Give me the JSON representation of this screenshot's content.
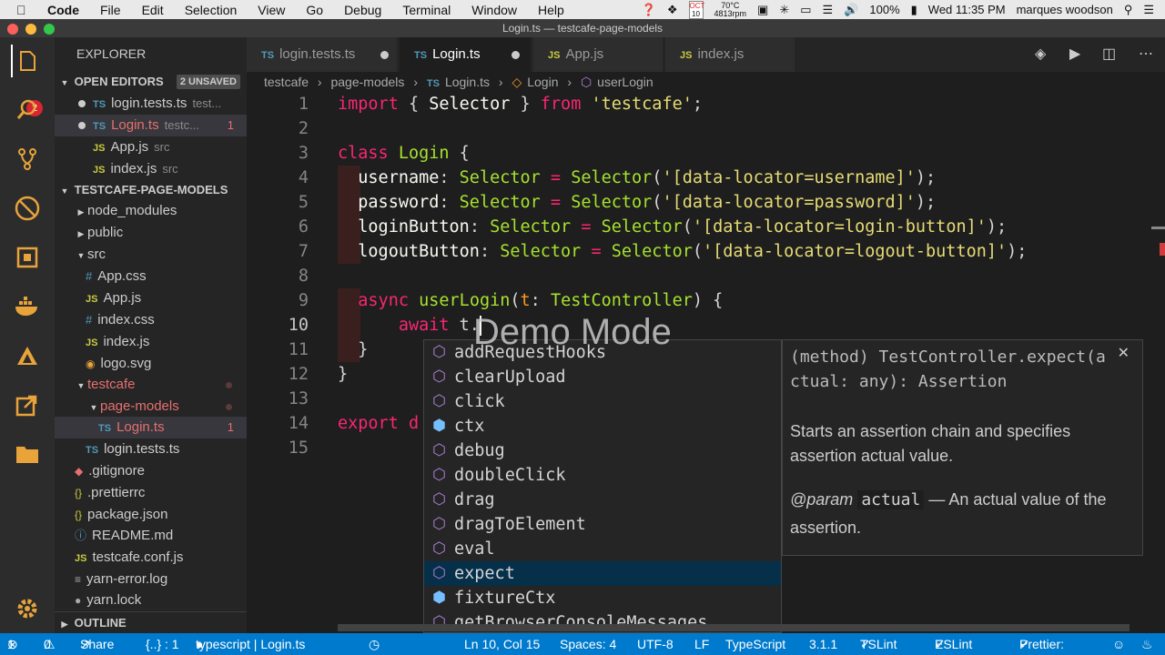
{
  "menubar": {
    "app": "Code",
    "items": [
      "File",
      "Edit",
      "Selection",
      "View",
      "Go",
      "Debug",
      "Terminal",
      "Window",
      "Help"
    ],
    "temp": "70°C",
    "rpm": "4813rpm",
    "date_day": "10",
    "date_month": "OCT",
    "battery": "100%",
    "clock": "Wed 11:35 PM",
    "user": "marques woodson"
  },
  "window_title": "Login.ts — testcafe-page-models",
  "activity": {
    "scm_badge": "2"
  },
  "explorer": {
    "title": "EXPLORER",
    "open_editors_label": "OPEN EDITORS",
    "unsaved_label": "2 UNSAVED",
    "open_editors": [
      {
        "icon": "TS",
        "name": "login.tests.ts",
        "hint": "test..."
      },
      {
        "icon": "TS",
        "name": "Login.ts",
        "hint": "testc...",
        "problems": "1"
      },
      {
        "icon": "JS",
        "name": "App.js",
        "hint": "src"
      },
      {
        "icon": "JS",
        "name": "index.js",
        "hint": "src"
      }
    ],
    "project_label": "TESTCAFE-PAGE-MODELS",
    "tree": [
      {
        "name": "node_modules",
        "kind": "folder"
      },
      {
        "name": "public",
        "kind": "folder"
      },
      {
        "name": "src",
        "kind": "folder-open"
      },
      {
        "name": "App.css",
        "kind": "css"
      },
      {
        "name": "App.js",
        "kind": "js"
      },
      {
        "name": "index.css",
        "kind": "css"
      },
      {
        "name": "index.js",
        "kind": "js"
      },
      {
        "name": "logo.svg",
        "kind": "svg"
      },
      {
        "name": "testcafe",
        "kind": "folder-open"
      },
      {
        "name": "page-models",
        "kind": "folder-open"
      },
      {
        "name": "Login.ts",
        "kind": "ts",
        "problems": "1"
      },
      {
        "name": "login.tests.ts",
        "kind": "ts"
      },
      {
        "name": ".gitignore",
        "kind": "git"
      },
      {
        "name": ".prettierrc",
        "kind": "json"
      },
      {
        "name": "package.json",
        "kind": "json"
      },
      {
        "name": "README.md",
        "kind": "md"
      },
      {
        "name": "testcafe.conf.js",
        "kind": "js"
      },
      {
        "name": "yarn-error.log",
        "kind": "log"
      },
      {
        "name": "yarn.lock",
        "kind": "lock"
      }
    ],
    "outline_label": "OUTLINE"
  },
  "tabs": [
    {
      "icon": "TS",
      "label": "login.tests.ts"
    },
    {
      "icon": "TS",
      "label": "Login.ts"
    },
    {
      "icon": "JS",
      "label": "App.js"
    },
    {
      "icon": "JS",
      "label": "index.js"
    }
  ],
  "breadcrumb": [
    "testcafe",
    "page-models",
    "Login.ts",
    "Login",
    "userLogin"
  ],
  "editor": {
    "line_numbers": [
      "1",
      "2",
      "3",
      "4",
      "5",
      "6",
      "7",
      "8",
      "9",
      "10",
      "11",
      "12",
      "13",
      "14",
      "15"
    ]
  },
  "suggestions": [
    {
      "label": "addRequestHooks",
      "kind": "method"
    },
    {
      "label": "clearUpload",
      "kind": "method"
    },
    {
      "label": "click",
      "kind": "method"
    },
    {
      "label": "ctx",
      "kind": "field"
    },
    {
      "label": "debug",
      "kind": "method"
    },
    {
      "label": "doubleClick",
      "kind": "method"
    },
    {
      "label": "drag",
      "kind": "method"
    },
    {
      "label": "dragToElement",
      "kind": "method"
    },
    {
      "label": "eval",
      "kind": "method"
    },
    {
      "label": "expect",
      "kind": "method"
    },
    {
      "label": "fixtureCtx",
      "kind": "field"
    },
    {
      "label": "getBrowserConsoleMessages",
      "kind": "method"
    }
  ],
  "docs": {
    "signature": "(method) TestController.expect(actual: any): Assertion",
    "description": "Starts an assertion chain and specifies assertion actual value.",
    "param_tag": "@param",
    "param_name": "actual",
    "param_desc": "— An actual value of the assertion."
  },
  "overlay": "Demo Mode",
  "status": {
    "errors": "1",
    "warnings": "0",
    "share": "Share",
    "symbol": "{..} : 1",
    "mode": "typescript | Login.ts",
    "position": "Ln 10, Col 15",
    "spaces": "Spaces: 4",
    "encoding": "UTF-8",
    "eol": "LF",
    "language": "TypeScript",
    "version": "3.1.1",
    "tslint": "TSLint",
    "eslint": "ESLint",
    "prettier": "Prettier:"
  }
}
